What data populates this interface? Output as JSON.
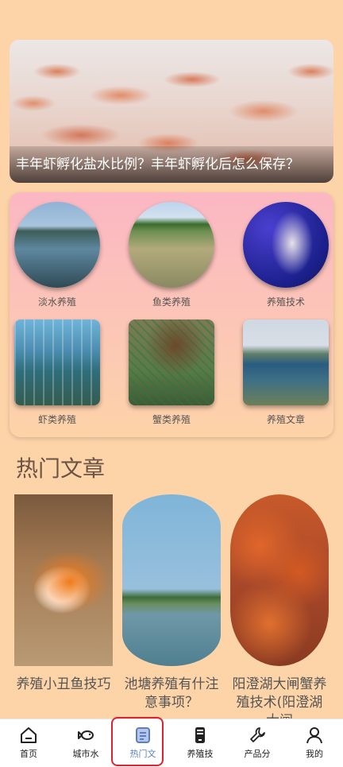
{
  "banner": {
    "title": "丰年虾孵化盐水比例？丰年虾孵化后怎么保存？"
  },
  "categories": [
    {
      "label": "淡水养殖",
      "icon": "freshwater-farm-photo"
    },
    {
      "label": "鱼类养殖",
      "icon": "fish-pond-photo"
    },
    {
      "label": "养殖技术",
      "icon": "aquarium-fish-photo"
    },
    {
      "label": "虾类养殖",
      "icon": "shrimp-greenhouse-photo"
    },
    {
      "label": "蟹类养殖",
      "icon": "crab-net-photo"
    },
    {
      "label": "养殖文章",
      "icon": "fish-cages-photo"
    }
  ],
  "hot_section": {
    "title": "热门文章",
    "articles": [
      {
        "title": "养殖小丑鱼技巧"
      },
      {
        "title": "池塘养殖有什注意事项？"
      },
      {
        "title": "阳澄湖大闸蟹养殖技术(阳澄湖大闸"
      }
    ]
  },
  "tabbar": {
    "items": [
      {
        "label": "首页",
        "icon": "home-icon"
      },
      {
        "label": "城市水",
        "icon": "fish-icon"
      },
      {
        "label": "热门文",
        "icon": "article-icon"
      },
      {
        "label": "养殖技",
        "icon": "phone-icon"
      },
      {
        "label": "产品分",
        "icon": "wrench-icon"
      },
      {
        "label": "我的",
        "icon": "user-icon"
      }
    ],
    "active_color": "#5b7fc4"
  }
}
